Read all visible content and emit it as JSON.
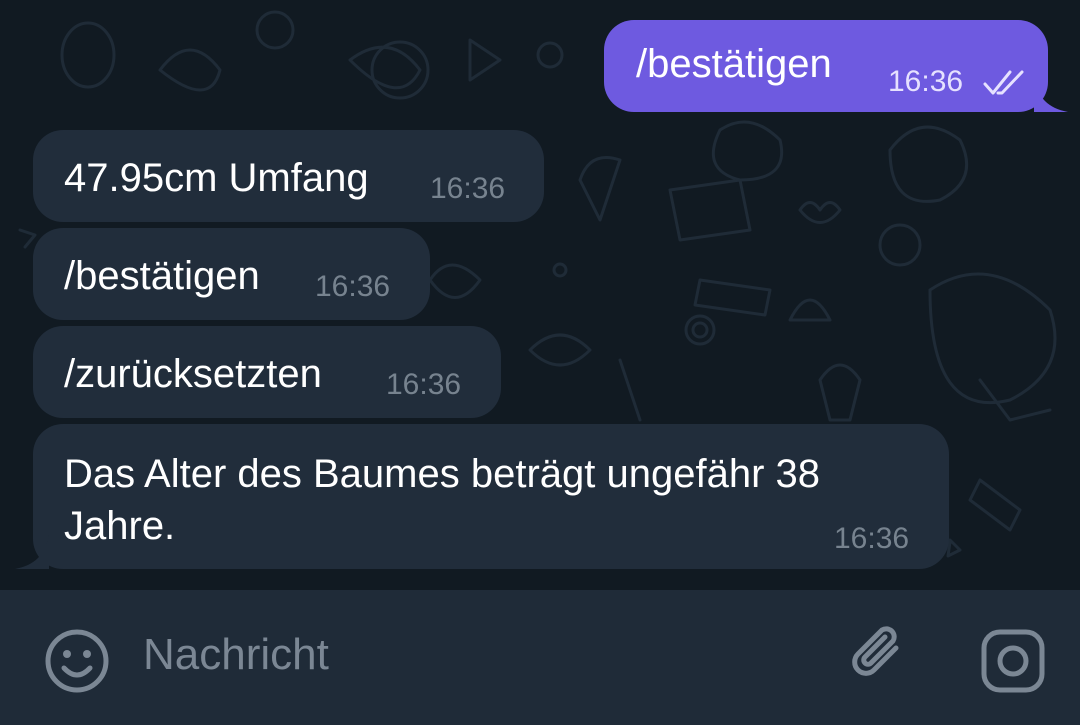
{
  "messages": [
    {
      "direction": "outgoing",
      "text": "/bestätigen",
      "time": "16:36",
      "status_icon": "double-check-icon"
    },
    {
      "direction": "incoming",
      "text": "47.95cm Umfang",
      "time": "16:36"
    },
    {
      "direction": "incoming",
      "text": "/bestätigen",
      "time": "16:36"
    },
    {
      "direction": "incoming",
      "text": "/zurücksetzten",
      "time": "16:36"
    },
    {
      "direction": "incoming",
      "text_line1": "Das Alter des Baumes beträgt ungefähr 38",
      "text_line2": "Jahre.",
      "time": "16:36"
    }
  ],
  "input": {
    "placeholder": "Nachricht",
    "left_icon": "emoji-icon",
    "attach_icon": "paperclip-icon",
    "right_icon": "camera-icon"
  },
  "colors": {
    "background": "#111a22",
    "incoming_bubble": "#212d3b",
    "outgoing_bubble": "#6e5ae0",
    "input_bar": "#1f2b38"
  }
}
